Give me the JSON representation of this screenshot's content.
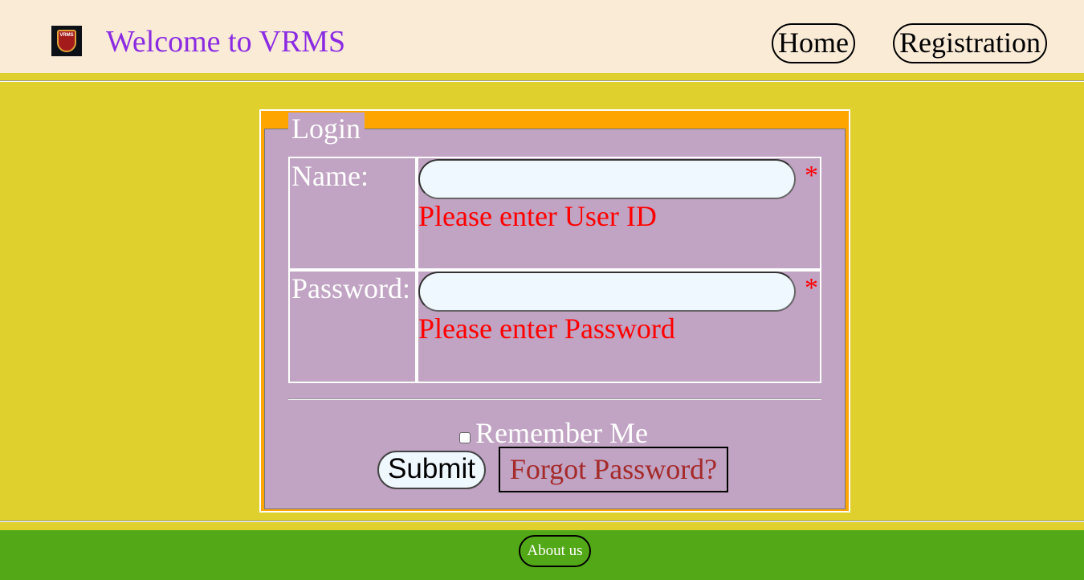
{
  "header": {
    "logo_text": "VRMS",
    "title": "Welcome to VRMS",
    "nav": [
      {
        "label": "Home"
      },
      {
        "label": "Registration"
      }
    ]
  },
  "login": {
    "legend": "Login",
    "name_label": "Name:",
    "name_value": "",
    "name_error": "Please enter User ID",
    "password_label": "Password:",
    "password_value": "",
    "password_error": "Please enter Password",
    "required_mark": "*",
    "remember_label": "Remember Me",
    "remember_checked": false,
    "submit_label": "Submit",
    "forgot_label": "Forgot Password?"
  },
  "footer": {
    "about_label": "About us"
  },
  "colors": {
    "header_bg": "#FAEBD7",
    "page_bg": "#DFD02E",
    "form_bg": "#C1A3C3",
    "frame": "#FFA500",
    "footer_bg": "#53A818",
    "title": "#8A2BE2",
    "error": "#FF0000",
    "link": "#A52A2A"
  }
}
